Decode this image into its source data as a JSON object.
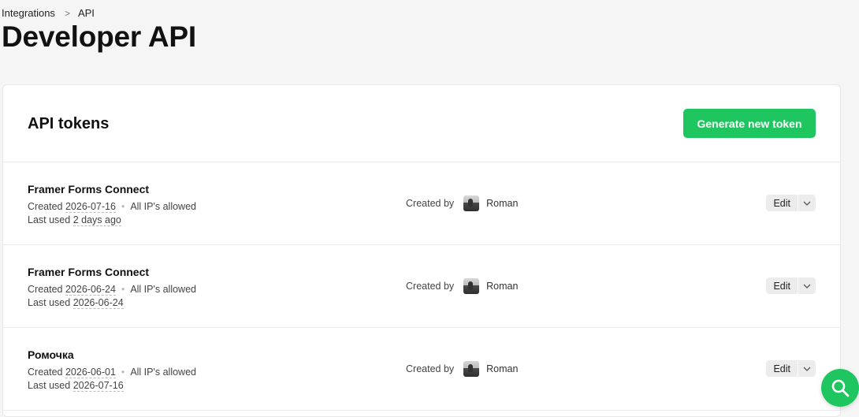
{
  "breadcrumb": {
    "parent": "Integrations",
    "separator": ">",
    "current": "API"
  },
  "page": {
    "title": "Developer API"
  },
  "card": {
    "title": "API tokens",
    "generate_button": "Generate new token"
  },
  "tokens": [
    {
      "name": "Framer Forms Connect",
      "created_label": "Created",
      "created_date": "2026-07-16",
      "ip_text": "All IP's allowed",
      "last_used_label": "Last used",
      "last_used": "2 days ago",
      "created_by_label": "Created by",
      "author": "Roman",
      "edit_label": "Edit"
    },
    {
      "name": "Framer Forms Connect",
      "created_label": "Created",
      "created_date": "2026-06-24",
      "ip_text": "All IP's allowed",
      "last_used_label": "Last used",
      "last_used": "2026-06-24",
      "created_by_label": "Created by",
      "author": "Roman",
      "edit_label": "Edit"
    },
    {
      "name": "Ромочка",
      "created_label": "Created",
      "created_date": "2026-06-01",
      "ip_text": "All IP's allowed",
      "last_used_label": "Last used",
      "last_used": "2026-07-16",
      "created_by_label": "Created by",
      "author": "Roman",
      "edit_label": "Edit"
    }
  ],
  "icons": {
    "chevron": "chevron-down-icon",
    "help": "search-icon"
  },
  "colors": {
    "accent": "#1fc660",
    "background": "#f5f5f5",
    "card": "#ffffff"
  }
}
